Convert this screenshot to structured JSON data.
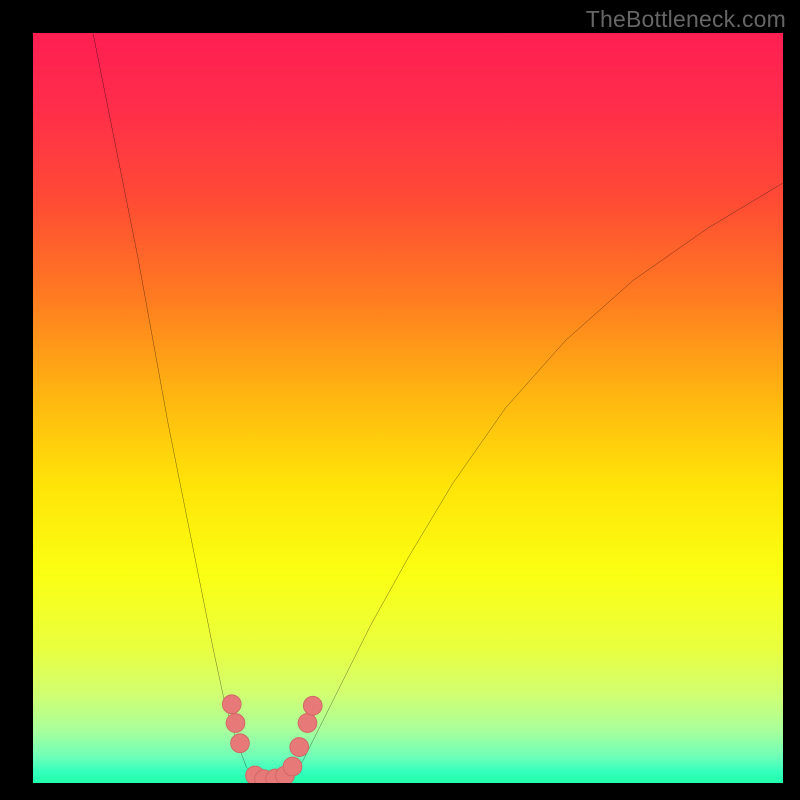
{
  "watermark": "TheBottleneck.com",
  "colors": {
    "gradient_stops": [
      {
        "offset": 0.0,
        "color": "#ff1f53"
      },
      {
        "offset": 0.1,
        "color": "#ff2d4a"
      },
      {
        "offset": 0.22,
        "color": "#ff4a35"
      },
      {
        "offset": 0.35,
        "color": "#ff7a21"
      },
      {
        "offset": 0.48,
        "color": "#ffb411"
      },
      {
        "offset": 0.6,
        "color": "#ffe308"
      },
      {
        "offset": 0.72,
        "color": "#fbff12"
      },
      {
        "offset": 0.82,
        "color": "#e9ff3f"
      },
      {
        "offset": 0.88,
        "color": "#d2ff70"
      },
      {
        "offset": 0.93,
        "color": "#a9ff9c"
      },
      {
        "offset": 0.965,
        "color": "#6effb8"
      },
      {
        "offset": 0.985,
        "color": "#34ffbd"
      },
      {
        "offset": 1.0,
        "color": "#1fffad"
      }
    ],
    "curve_stroke": "#000000",
    "marker_fill": "#e77a78",
    "marker_stroke": "#cf6765"
  },
  "chart_data": {
    "type": "line",
    "title": "",
    "xlabel": "",
    "ylabel": "",
    "xlim": [
      0,
      100
    ],
    "ylim": [
      0,
      100
    ],
    "grid": false,
    "legend": false,
    "series": [
      {
        "name": "left-branch",
        "x": [
          8,
          10,
          12,
          14,
          16,
          18,
          20,
          22,
          24,
          25.5,
          27,
          28.5,
          30
        ],
        "y": [
          100,
          90,
          80,
          70,
          59,
          48,
          38,
          28,
          18,
          11,
          6,
          2,
          0
        ]
      },
      {
        "name": "right-branch",
        "x": [
          34,
          36,
          38,
          41,
          45,
          50,
          56,
          63,
          71,
          80,
          90,
          100
        ],
        "y": [
          0,
          3,
          7,
          13,
          21,
          30,
          40,
          50,
          59,
          67,
          74,
          80
        ]
      },
      {
        "name": "valley-floor",
        "x": [
          30,
          31,
          32,
          33,
          34
        ],
        "y": [
          0,
          0,
          0,
          0,
          0
        ]
      }
    ],
    "markers": [
      {
        "x": 26.5,
        "y": 10.5
      },
      {
        "x": 27.0,
        "y": 8.0
      },
      {
        "x": 27.6,
        "y": 5.3
      },
      {
        "x": 29.6,
        "y": 1.0
      },
      {
        "x": 30.8,
        "y": 0.5
      },
      {
        "x": 32.3,
        "y": 0.6
      },
      {
        "x": 33.6,
        "y": 1.0
      },
      {
        "x": 34.6,
        "y": 2.2
      },
      {
        "x": 35.5,
        "y": 4.8
      },
      {
        "x": 36.6,
        "y": 8.0
      },
      {
        "x": 37.3,
        "y": 10.3
      }
    ],
    "marker_radius_pct": 1.25
  }
}
